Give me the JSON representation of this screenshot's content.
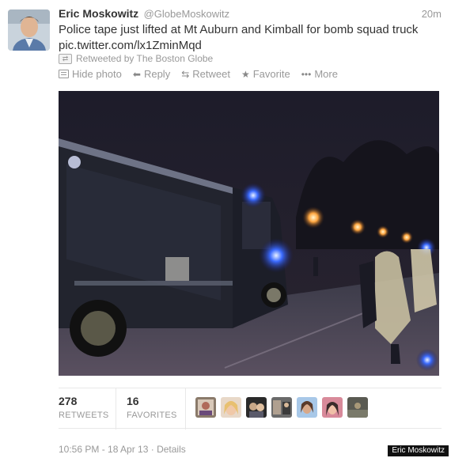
{
  "author": {
    "full_name": "Eric Moskowitz",
    "screen_name": "@GlobeMoskowitz"
  },
  "tweet": {
    "time_ago": "20m",
    "text": "Police tape just lifted at Mt Auburn and Kimball for bomb squad truck",
    "link": "pic.twitter.com/lx1ZminMqd",
    "retweeted_by": "Retweeted by The Boston Globe"
  },
  "actions": {
    "hide_photo": "Hide photo",
    "reply": "Reply",
    "retweet": "Retweet",
    "favorite": "Favorite",
    "more": "More"
  },
  "stats": {
    "retweets_count": "278",
    "retweets_label": "RETWEETS",
    "favorites_count": "16",
    "favorites_label": "FAVORITES"
  },
  "footer": {
    "timestamp": "10:56 PM - 18 Apr 13",
    "separator": " · ",
    "details_link": "Details"
  },
  "credit": "Eric Moskowitz",
  "icons": [
    "hide-photo-icon",
    "reply-icon",
    "retweet-icon",
    "favorite-icon",
    "more-icon",
    "retweeted-icon"
  ]
}
